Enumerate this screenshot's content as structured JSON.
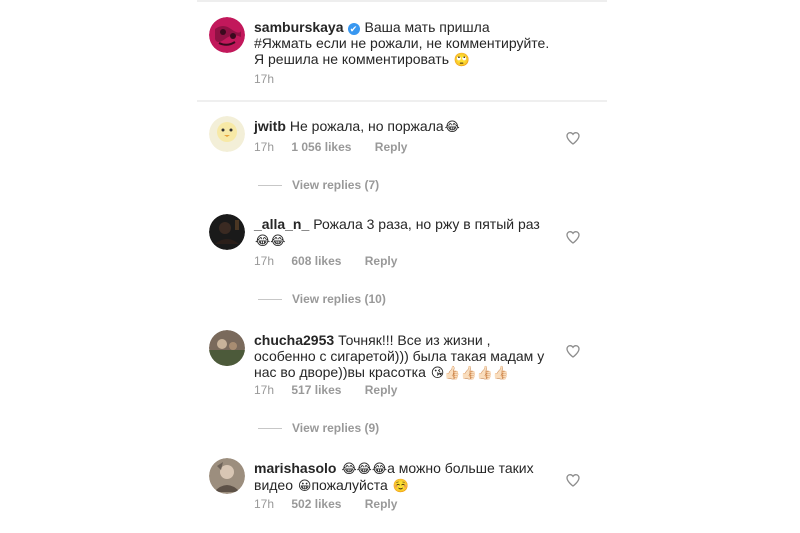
{
  "caption": {
    "username": "samburskaya",
    "verified_mark": "✔",
    "text": "Ваша мать пришла #Яжмать если не рожали, не комментируйте. Я решила не комментировать",
    "emoji": "🙄",
    "time": "17h",
    "avatar_icon": "profile-photo-magenta"
  },
  "comments": [
    {
      "username": "jwitb",
      "text": "Не рожала, но поржала",
      "emoji": "😂",
      "time": "17h",
      "likes": "1 056 likes",
      "reply_label": "Reply",
      "view_replies": "View replies (7)",
      "avatar_icon": "duckling-avatar"
    },
    {
      "username": "_alla_n_",
      "text": "Рожала 3 раза, но ржу в пятый раз",
      "emoji": "😂😂",
      "time": "17h",
      "likes": "608 likes",
      "reply_label": "Reply",
      "view_replies": "View replies (10)",
      "avatar_icon": "dark-photo-avatar"
    },
    {
      "username": "chucha2953",
      "text": "Точняк!!! Все из жизни , особенно с сигаретой))) была такая мадам у нас во дворе))вы красотка",
      "emoji": "😘👍🏻👍🏻👍🏻👍🏻",
      "time": "17h",
      "likes": "517 likes",
      "reply_label": "Reply",
      "view_replies": "View replies (9)",
      "avatar_icon": "photo-avatar"
    },
    {
      "username": "marishasolo",
      "text_parts": [
        "😂😂😂",
        "а можно больше таких видео ",
        "😀",
        "пожалуйста ",
        "☺️"
      ],
      "time": "17h",
      "likes": "502 likes",
      "reply_label": "Reply",
      "avatar_icon": "photo-avatar"
    }
  ],
  "colors": {
    "text": "#262626",
    "meta": "#999999",
    "verified": "#3897f0",
    "heart_stroke": "#8e8e8e"
  },
  "icons": {
    "like": "heart-outline-icon",
    "verified": "verified-badge-icon"
  }
}
